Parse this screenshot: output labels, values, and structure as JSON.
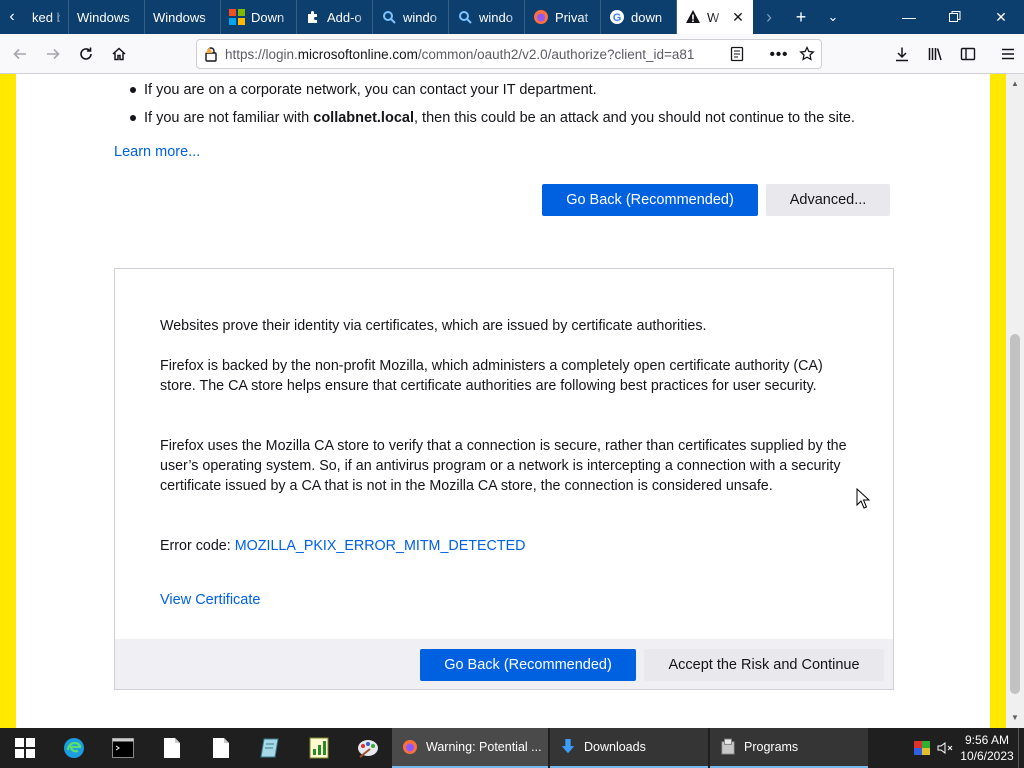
{
  "browser": {
    "tabs": [
      {
        "label": "ked by",
        "icon": "none"
      },
      {
        "label": "Windows",
        "icon": "none"
      },
      {
        "label": "Windows",
        "icon": "none"
      },
      {
        "label": "Down",
        "icon": "microsoft-logo-icon"
      },
      {
        "label": "Add-o",
        "icon": "puzzle-icon"
      },
      {
        "label": "windo",
        "icon": "search-icon"
      },
      {
        "label": "windo",
        "icon": "search-icon"
      },
      {
        "label": "Privat",
        "icon": "firefox-icon"
      },
      {
        "label": "down",
        "icon": "google-icon"
      },
      {
        "label": "W",
        "icon": "warning-icon",
        "active": true
      }
    ],
    "url": {
      "prefix": "https://login.",
      "domain": "microsoftonline.com",
      "path": "/common/oauth2/v2.0/authorize?client_id=a81"
    }
  },
  "page": {
    "bullets": [
      {
        "text": "If you are on a corporate network, you can contact your IT department."
      },
      {
        "before": "If you are not familiar with ",
        "bold": "collabnet.local",
        "after": ", then this could be an attack and you should not continue to the site."
      }
    ],
    "learn_more": "Learn more...",
    "go_back_label": "Go Back (Recommended)",
    "advanced_label": "Advanced...",
    "advanced": {
      "p1": "Websites prove their identity via certificates, which are issued by certificate authorities.",
      "p2": "Firefox is backed by the non-profit Mozilla, which administers a completely open certificate authority (CA) store. The CA store helps ensure that certificate authorities are following best practices for user security.",
      "p3": "Firefox uses the Mozilla CA store to verify that a connection is secure, rather than certificates supplied by the user’s operating system. So, if an antivirus program or a network is intercepting a connection with a security certificate issued by a CA that is not in the Mozilla CA store, the connection is considered unsafe.",
      "error_label": "Error code: ",
      "error_code": "MOZILLA_PKIX_ERROR_MITM_DETECTED",
      "view_certificate": "View Certificate",
      "go_back_label": "Go Back (Recommended)",
      "accept_label": "Accept the Risk and Continue"
    }
  },
  "taskbar": {
    "tasks": [
      {
        "label": "Warning: Potential ...",
        "icon": "firefox-icon",
        "active": true
      },
      {
        "label": "Downloads",
        "icon": "download-arrow-icon"
      },
      {
        "label": "Programs",
        "icon": "folder-icon"
      }
    ],
    "time": "9:56 AM",
    "date": "10/6/2023"
  },
  "colors": {
    "accent_blue": "#0061e0",
    "warning_border": "#ffe900",
    "tabstrip": "#0c3e6e"
  }
}
